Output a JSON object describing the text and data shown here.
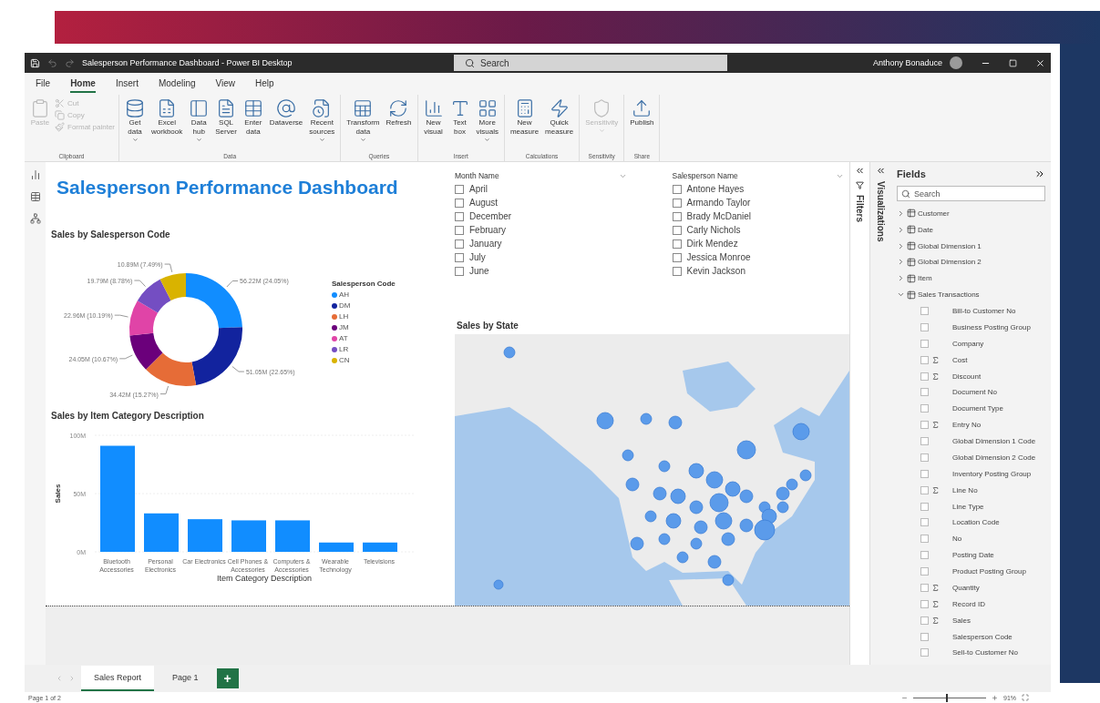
{
  "window": {
    "title": "Salesperson Performance Dashboard - Power BI Desktop",
    "search": {
      "placeholder": "Search"
    },
    "user": "Anthony Bonaduce"
  },
  "menu_tabs": [
    {
      "label": "File",
      "selected": false
    },
    {
      "label": "Home",
      "selected": true
    },
    {
      "label": "Insert",
      "selected": false
    },
    {
      "label": "Modeling",
      "selected": false
    },
    {
      "label": "View",
      "selected": false
    },
    {
      "label": "Help",
      "selected": false
    }
  ],
  "ribbon": [
    {
      "group": "Clipboard",
      "items": [
        {
          "kind": "large",
          "lines": [
            "Paste"
          ],
          "menu": false,
          "disabled": true
        },
        {
          "kind": "small",
          "lines": [
            "Cut"
          ],
          "menu": false,
          "disabled": true
        },
        {
          "kind": "small",
          "lines": [
            "Copy"
          ],
          "menu": false,
          "disabled": true
        },
        {
          "kind": "small",
          "lines": [
            "Format painter"
          ],
          "menu": false,
          "disabled": true
        }
      ]
    },
    {
      "group": "Data",
      "items": [
        {
          "kind": "large",
          "lines": [
            "Get",
            "data"
          ],
          "menu": true,
          "disabled": false
        },
        {
          "kind": "large",
          "lines": [
            "Excel",
            "workbook"
          ],
          "menu": false,
          "disabled": false
        },
        {
          "kind": "large",
          "lines": [
            "Data",
            "hub"
          ],
          "menu": true,
          "disabled": false
        },
        {
          "kind": "large",
          "lines": [
            "SQL",
            "Server"
          ],
          "menu": false,
          "disabled": false
        },
        {
          "kind": "large",
          "lines": [
            "Enter",
            "data"
          ],
          "menu": false,
          "disabled": false
        },
        {
          "kind": "large",
          "lines": [
            "Dataverse"
          ],
          "menu": false,
          "disabled": false
        },
        {
          "kind": "large",
          "lines": [
            "Recent",
            "sources"
          ],
          "menu": true,
          "disabled": false
        }
      ]
    },
    {
      "group": "Queries",
      "items": [
        {
          "kind": "large",
          "lines": [
            "Transform",
            "data"
          ],
          "menu": true,
          "disabled": false
        },
        {
          "kind": "large",
          "lines": [
            "Refresh"
          ],
          "menu": false,
          "disabled": false
        }
      ]
    },
    {
      "group": "Insert",
      "items": [
        {
          "kind": "large",
          "lines": [
            "New",
            "visual"
          ],
          "menu": false,
          "disabled": false
        },
        {
          "kind": "large",
          "lines": [
            "Text",
            "box"
          ],
          "menu": false,
          "disabled": false
        },
        {
          "kind": "large",
          "lines": [
            "More",
            "visuals"
          ],
          "menu": true,
          "disabled": false
        }
      ]
    },
    {
      "group": "Calculations",
      "items": [
        {
          "kind": "large",
          "lines": [
            "New",
            "measure"
          ],
          "menu": false,
          "disabled": false
        },
        {
          "kind": "large",
          "lines": [
            "Quick",
            "measure"
          ],
          "menu": false,
          "disabled": false
        }
      ]
    },
    {
      "group": "Sensitivity",
      "items": [
        {
          "kind": "large",
          "lines": [
            "Sensitivity"
          ],
          "menu": true,
          "disabled": true
        }
      ]
    },
    {
      "group": "Share",
      "items": [
        {
          "kind": "large",
          "lines": [
            "Publish"
          ],
          "menu": false,
          "disabled": false
        }
      ]
    }
  ],
  "report": {
    "title": "Salesperson Performance Dashboard",
    "donut": {
      "heading": "Sales by Salesperson Code",
      "legend_title": "Salesperson Code",
      "chart_data": {
        "type": "donut",
        "categories": [
          "AH",
          "DM",
          "LH",
          "JM",
          "AT",
          "LR",
          "CN"
        ],
        "series": [
          {
            "values": [
              24.05,
              22.65,
              15.27,
              10.67,
              10.19,
              8.78,
              7.49
            ]
          }
        ],
        "value_labels": [
          "56.22M (24.05%)",
          "51.05M (22.65%)",
          "34.42M (15.27%)",
          "24.05M (10.67%)",
          "22.96M (10.19%)",
          "19.79M (8.78%)",
          "10.89M (7.49%)"
        ],
        "colors": [
          "#118dff",
          "#12239e",
          "#e66c37",
          "#6b007b",
          "#e044a7",
          "#744ec2",
          "#d9b300"
        ]
      }
    },
    "bar": {
      "heading": "Sales by Item Category Description",
      "chart_data": {
        "type": "bar",
        "xlabel": "Item Category Description",
        "ylabel": "Sales",
        "categories": [
          "Bluetooth Accessories",
          "Personal Electronics",
          "Car Electronics",
          "Cell Phones & Accessories",
          "Computers & Accessories",
          "Wearable Technology",
          "Televisions"
        ],
        "series": [
          {
            "color": "#118dff",
            "values": [
              91,
              33,
              28,
              27,
              27,
              8,
              8
            ]
          }
        ],
        "ylim": [
          0,
          100
        ],
        "yticks": [
          {
            "value": 0,
            "label": "0M"
          },
          {
            "value": 50,
            "label": "50M"
          },
          {
            "value": 100,
            "label": "100M"
          }
        ]
      }
    },
    "slicers": [
      {
        "title": "Month Name",
        "items": [
          {
            "label": "April",
            "checked": false
          },
          {
            "label": "August",
            "checked": false
          },
          {
            "label": "December",
            "checked": false
          },
          {
            "label": "February",
            "checked": false
          },
          {
            "label": "January",
            "checked": false
          },
          {
            "label": "July",
            "checked": false
          },
          {
            "label": "June",
            "checked": false
          }
        ]
      },
      {
        "title": "Salesperson Name",
        "items": [
          {
            "label": "Antone Hayes",
            "checked": false
          },
          {
            "label": "Armando Taylor",
            "checked": false
          },
          {
            "label": "Brady McDaniel",
            "checked": false
          },
          {
            "label": "Carly Nichols",
            "checked": false
          },
          {
            "label": "Dirk Mendez",
            "checked": false
          },
          {
            "label": "Jessica Monroe",
            "checked": false
          },
          {
            "label": "Kevin Jackson",
            "checked": false
          }
        ]
      }
    ],
    "map": {
      "heading": "Sales by State"
    }
  },
  "panes": {
    "filters": "Filters",
    "visualizations": "Visualizations",
    "fields": {
      "title": "Fields",
      "search": {
        "placeholder": "Search"
      },
      "tables": [
        {
          "name": "Customer",
          "expanded": false
        },
        {
          "name": "Date",
          "expanded": false
        },
        {
          "name": "Global Dimension 1",
          "expanded": false
        },
        {
          "name": "Global Dimension 2",
          "expanded": false
        },
        {
          "name": "Item",
          "expanded": false
        },
        {
          "name": "Sales Transactions",
          "expanded": true,
          "children": [
            {
              "name": "Bill-to Customer No",
              "kind": "plain",
              "checked": false
            },
            {
              "name": "Business Posting Group",
              "kind": "plain",
              "checked": false
            },
            {
              "name": "Company",
              "kind": "plain",
              "checked": false
            },
            {
              "name": "Cost",
              "kind": "sum",
              "checked": false
            },
            {
              "name": "Discount",
              "kind": "sum",
              "checked": false
            },
            {
              "name": "Document No",
              "kind": "plain",
              "checked": false
            },
            {
              "name": "Document Type",
              "kind": "plain",
              "checked": false
            },
            {
              "name": "Entry No",
              "kind": "sum",
              "checked": false
            },
            {
              "name": "Global Dimension 1 Code",
              "kind": "plain",
              "checked": false
            },
            {
              "name": "Global Dimension 2 Code",
              "kind": "plain",
              "checked": false
            },
            {
              "name": "Inventory Posting Group",
              "kind": "plain",
              "checked": false
            },
            {
              "name": "Line No",
              "kind": "sum",
              "checked": false
            },
            {
              "name": "Line Type",
              "kind": "plain",
              "checked": false
            },
            {
              "name": "Location Code",
              "kind": "plain",
              "checked": false
            },
            {
              "name": "No",
              "kind": "plain",
              "checked": false
            },
            {
              "name": "Posting Date",
              "kind": "plain",
              "checked": false
            },
            {
              "name": "Product Posting Group",
              "kind": "plain",
              "checked": false
            },
            {
              "name": "Quantity",
              "kind": "sum",
              "checked": false
            },
            {
              "name": "Record ID",
              "kind": "sum",
              "checked": false
            },
            {
              "name": "Sales",
              "kind": "sum",
              "checked": false
            },
            {
              "name": "Salesperson Code",
              "kind": "plain",
              "checked": false
            },
            {
              "name": "Sell-to Customer No",
              "kind": "plain",
              "checked": false
            }
          ]
        }
      ]
    }
  },
  "page_tabs": [
    {
      "label": "Sales Report",
      "selected": true
    },
    {
      "label": "Page 1",
      "selected": false
    }
  ],
  "add_page": "+",
  "status_bar": {
    "page": "Page 1 of 2",
    "zoom": "91%",
    "zoom_slider": {
      "level": 0.45
    }
  }
}
